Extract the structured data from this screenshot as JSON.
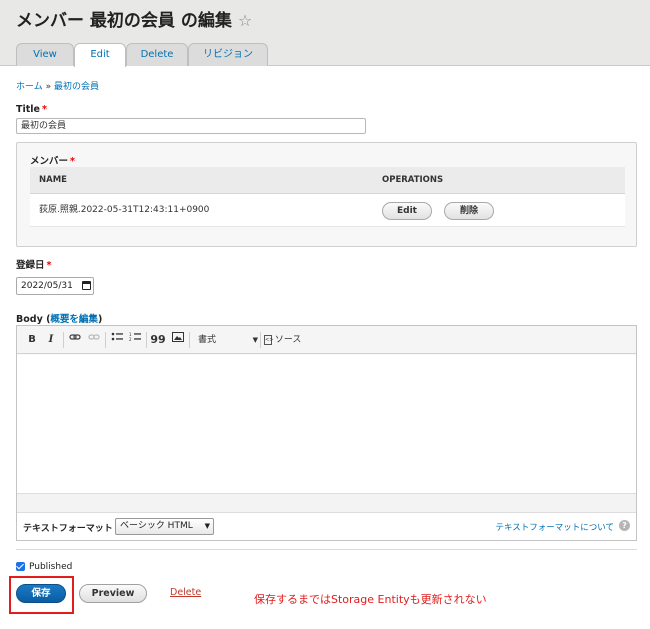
{
  "header": {
    "title": "メンバー 最初の会員 の編集",
    "tabs": [
      {
        "label": "View"
      },
      {
        "label": "Edit"
      },
      {
        "label": "Delete"
      },
      {
        "label": "リビジョン"
      }
    ]
  },
  "breadcrumb": {
    "home": "ホーム",
    "sep": "»",
    "current": "最初の会員"
  },
  "form": {
    "title_label": "Title",
    "title_value": "最初の会員",
    "member": {
      "label": "メンバー",
      "columns": [
        "NAME",
        "OPERATIONS"
      ],
      "rows": [
        {
          "name": "荻原.照親.2022-05-31T12:43:11+0900",
          "edit": "Edit",
          "delete": "削除"
        }
      ]
    },
    "date_label": "登録日",
    "date_value": "2022/05/31",
    "body_label": "Body",
    "body_link": "概要を編集",
    "toolbar": {
      "bold": "B",
      "italic": "I",
      "quote": "99",
      "format": "書式",
      "source": "ソース"
    },
    "format_label": "テキストフォーマット",
    "format_value": "ベーシック HTML",
    "format_help": "テキストフォーマットについて",
    "published_label": "Published",
    "published": true
  },
  "actions": {
    "save": "保存",
    "preview": "Preview",
    "delete": "Delete"
  },
  "annotation": "保存するまではStorage Entityも更新されない",
  "colors": {
    "accent": "#0071b3",
    "primary": "#0a5da3",
    "alert": "#e31c1c"
  }
}
